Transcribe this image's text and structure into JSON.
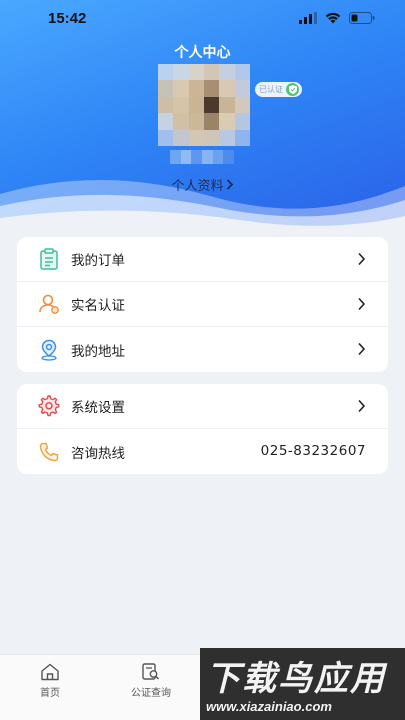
{
  "status_bar": {
    "time": "15:42"
  },
  "header": {
    "title": "个人中心",
    "verify_badge": "已认证",
    "profile_link": "个人资料"
  },
  "menu_group_1": [
    {
      "label": "我的订单",
      "icon": "clipboard-icon"
    },
    {
      "label": "实名认证",
      "icon": "user-icon"
    },
    {
      "label": "我的地址",
      "icon": "location-pin-icon"
    }
  ],
  "menu_group_2": [
    {
      "label": "系统设置",
      "icon": "gear-icon"
    },
    {
      "label": "咨询热线",
      "icon": "phone-icon",
      "value": "025-83232607"
    }
  ],
  "tabbar": [
    {
      "label": "首页",
      "icon": "home-icon"
    },
    {
      "label": "公证查询",
      "icon": "search-document-icon"
    }
  ],
  "watermark": {
    "main": "下载鸟应用",
    "url": "www.xiazainiao.com"
  },
  "colors": {
    "header_gradient_start": "#4aa8ff",
    "header_gradient_end": "#2a5fe8",
    "background": "#eef1f6",
    "order_icon": "#3dbf9c",
    "verify_icon": "#f28c3a",
    "address_icon": "#3a8fe8",
    "settings_icon": "#e24b4b",
    "phone_icon": "#f0a540"
  }
}
